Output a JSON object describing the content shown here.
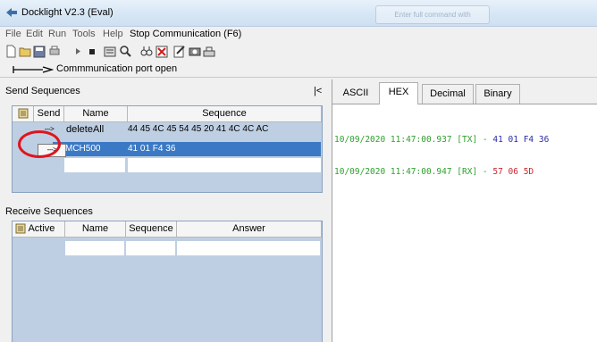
{
  "window": {
    "title": "Docklight V2.3 (Eval)",
    "ghost_tab": "Enter full command with"
  },
  "menu": {
    "file": "File",
    "edit": "Edit",
    "run": "Run",
    "tools": "Tools",
    "help": "Help",
    "stop": "Stop Communication  (F6)"
  },
  "toolbar": {
    "icons": [
      "new-file-icon",
      "open-folder-icon",
      "save-icon",
      "print-icon",
      "play-icon",
      "stop-icon",
      "settings-icon",
      "search-icon",
      "find-icon",
      "clear-icon",
      "macro-icon",
      "snapshot-icon",
      "keyboard-icon"
    ]
  },
  "status": {
    "text": "Commmunication port open"
  },
  "send": {
    "title": "Send Sequences",
    "collapse": "|<",
    "headers": {
      "send": "Send",
      "name": "Name",
      "sequence": "Sequence"
    },
    "rows": [
      {
        "button": "--->",
        "name": "deleteAll",
        "sequence": "44 45 4C 45 54 45 20 41 4C 4C AC"
      },
      {
        "button": "--->",
        "name": "MCH500",
        "sequence": "41 01 F4 36"
      }
    ]
  },
  "receive": {
    "title": "Receive Sequences",
    "headers": {
      "active": "Active",
      "name": "Name",
      "sequence": "Sequence",
      "answer": "Answer"
    }
  },
  "tabs": {
    "ascii": "ASCII",
    "hex": "HEX",
    "decimal": "Decimal",
    "binary": "Binary",
    "active": "HEX"
  },
  "log": [
    {
      "timestamp": "10/09/2020 11:47:00.937",
      "dir": "[TX]",
      "sep": "-",
      "data": "41 01 F4 36"
    },
    {
      "timestamp": "10/09/2020 11:47:00.947",
      "dir": "[RX]",
      "sep": "-",
      "data": "57 06 5D"
    }
  ],
  "colors": {
    "timestamp": "#2ea02e",
    "tx_data": "#2a2aa8",
    "rx_data": "#c8282e",
    "selection": "#3b79c4",
    "grid_bg": "#bfcfe3",
    "annotation": "#e0141f"
  }
}
